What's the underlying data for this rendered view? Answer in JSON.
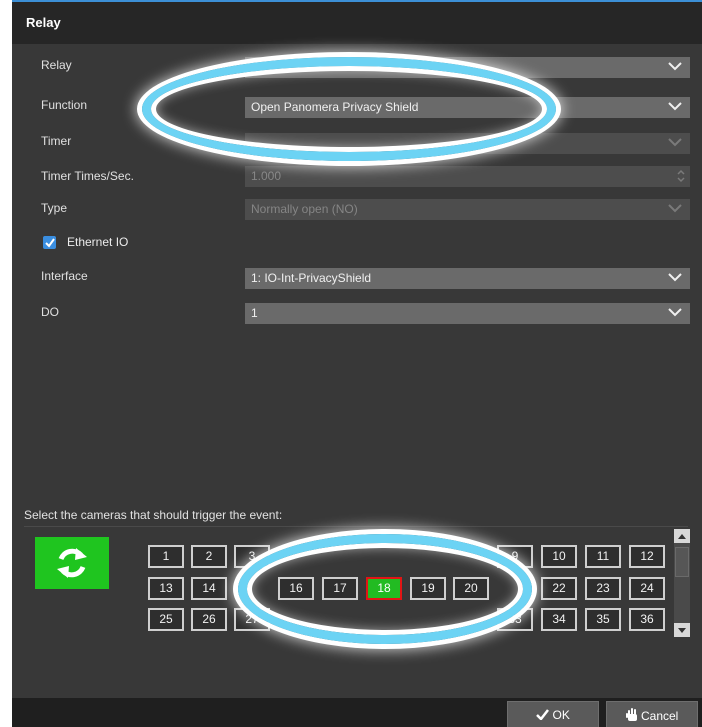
{
  "dialog": {
    "title": "Relay"
  },
  "form": {
    "relay": {
      "label": "Relay",
      "value": ""
    },
    "function": {
      "label": "Function",
      "value": "Open Panomera Privacy Shield"
    },
    "timer": {
      "label": "Timer",
      "value": ""
    },
    "timer_times": {
      "label": "Timer Times/Sec.",
      "value": "1.000"
    },
    "type": {
      "label": "Type",
      "value": "Normally open (NO)"
    },
    "ethernet_io": {
      "label": "Ethernet IO",
      "checked": true
    },
    "interface": {
      "label": "Interface",
      "value": "1: IO-Int-PrivacyShield"
    },
    "do": {
      "label": "DO",
      "value": "1"
    }
  },
  "cameras": {
    "caption": "Select the cameras that should trigger the event:",
    "refresh_icon": "refresh-icon",
    "selected": "18",
    "buttons": [
      "1",
      "2",
      "3",
      "9",
      "10",
      "11",
      "12",
      "13",
      "14",
      "16",
      "17",
      "18",
      "19",
      "20",
      "22",
      "23",
      "24",
      "25",
      "26",
      "27",
      "33",
      "34",
      "35",
      "36"
    ]
  },
  "footer": {
    "ok_label": "OK",
    "cancel_label": "Cancel"
  },
  "colors": {
    "accent": "#3a8ee0",
    "selected_camera": "#22bb22",
    "refresh": "#1fc51f",
    "annotation_ring": "#6cd3f4"
  }
}
